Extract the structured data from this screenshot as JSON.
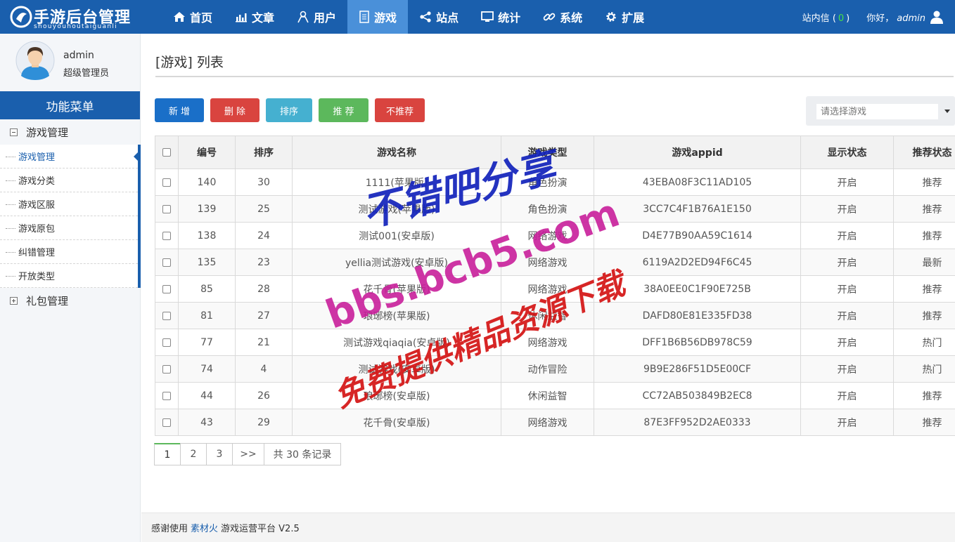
{
  "logo": {
    "title": "手游后台管理",
    "subtitle": "shouyouhoutaiguanli"
  },
  "nav": [
    {
      "label": "首页",
      "icon": "home-icon"
    },
    {
      "label": "文章",
      "icon": "bar-chart-icon"
    },
    {
      "label": "用户",
      "icon": "user-icon"
    },
    {
      "label": "游戏",
      "icon": "document-icon",
      "active": true
    },
    {
      "label": "站点",
      "icon": "share-icon"
    },
    {
      "label": "统计",
      "icon": "monitor-icon"
    },
    {
      "label": "系统",
      "icon": "link-icon"
    },
    {
      "label": "扩展",
      "icon": "gear-icon"
    }
  ],
  "header_right": {
    "messages_label": "站内信",
    "messages_open": "(",
    "messages_count": "0",
    "messages_close": ")",
    "greeting": "你好，",
    "username": "admin"
  },
  "user": {
    "name": "admin",
    "role": "超级管理员"
  },
  "sidebar": {
    "menu_title": "功能菜单",
    "groups": [
      {
        "label": "游戏管理",
        "expanded": true,
        "items": [
          "游戏管理",
          "游戏分类",
          "游戏区服",
          "游戏原包",
          "纠错管理",
          "开放类型"
        ]
      },
      {
        "label": "礼包管理",
        "expanded": false
      }
    ]
  },
  "page": {
    "title": "[游戏] 列表"
  },
  "toolbar": {
    "buttons": [
      {
        "label": "新 增",
        "color": "#1a6fc8"
      },
      {
        "label": "删 除",
        "color": "#d9443f"
      },
      {
        "label": "排序",
        "color": "#45b0d0"
      },
      {
        "label": "推 荐",
        "color": "#5cb85c"
      },
      {
        "label": "不推荐",
        "color": "#d9443f"
      }
    ],
    "search_placeholder": "请选择游戏"
  },
  "table": {
    "columns": [
      "编号",
      "排序",
      "游戏名称",
      "游戏类型",
      "游戏appid",
      "显示状态",
      "推荐状态"
    ],
    "rows": [
      [
        "140",
        "30",
        "1111(苹果版)",
        "角色扮演",
        "43EBA08F3C11AD105",
        "开启",
        "推荐"
      ],
      [
        "139",
        "25",
        "测试游戏(苹果版)",
        "角色扮演",
        "3CC7C4F1B76A1E150",
        "开启",
        "推荐"
      ],
      [
        "138",
        "24",
        "测试001(安卓版)",
        "网络游戏",
        "D4E77B90AA59C1614",
        "开启",
        "推荐"
      ],
      [
        "135",
        "23",
        "yellia测试游戏(安卓版)",
        "网络游戏",
        "6119A2D2ED94F6C45",
        "开启",
        "最新"
      ],
      [
        "85",
        "28",
        "花千骨(苹果版)",
        "网络游戏",
        "38A0EE0C1F90E725B",
        "开启",
        "推荐"
      ],
      [
        "81",
        "27",
        "琅琊榜(苹果版)",
        "休闲益智",
        "DAFD80E81E335FD38",
        "开启",
        "推荐"
      ],
      [
        "77",
        "21",
        "测试游戏qiaqia(安卓版)",
        "网络游戏",
        "DFF1B6B56DB978C59",
        "开启",
        "热门"
      ],
      [
        "74",
        "4",
        "测试游戏(安卓版)",
        "动作冒险",
        "9B9E286F51D5E00CF",
        "开启",
        "热门"
      ],
      [
        "44",
        "26",
        "琅琊榜(安卓版)",
        "休闲益智",
        "CC72AB503849B2EC8",
        "开启",
        "推荐"
      ],
      [
        "43",
        "29",
        "花千骨(安卓版)",
        "网络游戏",
        "87E3FF952D2AE0333",
        "开启",
        "推荐"
      ]
    ]
  },
  "pagination": {
    "pages": [
      "1",
      "2",
      "3"
    ],
    "next": ">>",
    "total": "共 30 条记录"
  },
  "footer": {
    "prefix": "感谢使用",
    "link": "素材火",
    "suffix": "游戏运营平台 V2.5"
  },
  "watermark": {
    "line1": "不错吧分享",
    "line2": "bbs.bcb5.com",
    "line3": "免费提供精品资源下载"
  }
}
